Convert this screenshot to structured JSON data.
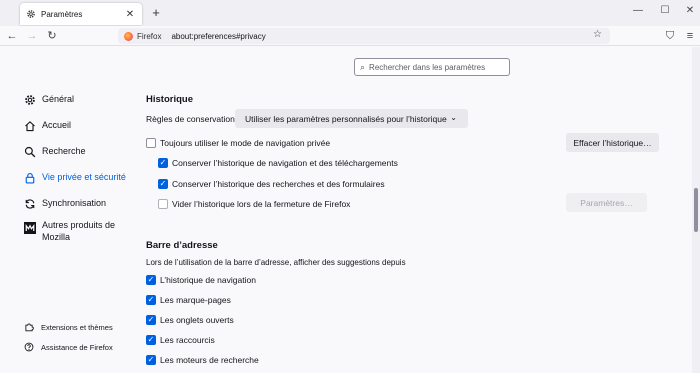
{
  "tab": {
    "title": "Paramètres",
    "icon": "gear-icon",
    "close": "✕"
  },
  "window": {
    "new_tab": "+",
    "minimize": "—",
    "maximize": "☐",
    "close": "✕"
  },
  "nav": {
    "back": "←",
    "forward": "→",
    "reload": "↻",
    "identity_label": "Firefox",
    "url": "about:preferences#privacy",
    "bookmark_star": "☆",
    "pocket": "⛉",
    "menu": "≡"
  },
  "search": {
    "placeholder": "Rechercher dans les paramètres"
  },
  "sidebar": {
    "items": [
      {
        "label": "Général",
        "icon": "gear-icon",
        "active": false
      },
      {
        "label": "Accueil",
        "icon": "home-icon",
        "active": false
      },
      {
        "label": "Recherche",
        "icon": "search-icon",
        "active": false
      },
      {
        "label": "Vie privée et sécurité",
        "icon": "lock-icon",
        "active": true
      },
      {
        "label": "Synchronisation",
        "icon": "sync-icon",
        "active": false
      },
      {
        "label": "Autres produits de Mozilla",
        "icon": "mozilla-m-icon",
        "active": false
      }
    ],
    "footer": [
      {
        "label": "Extensions et thèmes",
        "icon": "puzzle-icon"
      },
      {
        "label": "Assistance de Firefox",
        "icon": "help-icon"
      }
    ]
  },
  "history": {
    "heading": "Historique",
    "rules_label": "Règles de conservation",
    "rules_value": "Utiliser les paramètres personnalisés pour l’historique",
    "clear_button": "Effacer l’historique…",
    "settings_button": "Paramètres…",
    "options": [
      {
        "label": "Toujours utiliser le mode de navigation privée",
        "checked": false
      },
      {
        "label": "Conserver l’historique de navigation et des téléchargements",
        "checked": true
      },
      {
        "label": "Conserver l’historique des recherches et des formulaires",
        "checked": true
      },
      {
        "label": "Vider l’historique lors de la fermeture de Firefox",
        "checked": false
      }
    ]
  },
  "address_bar": {
    "heading": "Barre d’adresse",
    "description": "Lors de l’utilisation de la barre d’adresse, afficher des suggestions depuis",
    "options": [
      {
        "label": "L’historique de navigation",
        "checked": true
      },
      {
        "label": "Les marque-pages",
        "checked": true
      },
      {
        "label": "Les onglets ouverts",
        "checked": true
      },
      {
        "label": "Les raccourcis",
        "checked": true
      },
      {
        "label": "Les moteurs de recherche",
        "checked": true
      }
    ]
  },
  "colors": {
    "accent": "#0061e0",
    "background": "#f9f9fb"
  }
}
